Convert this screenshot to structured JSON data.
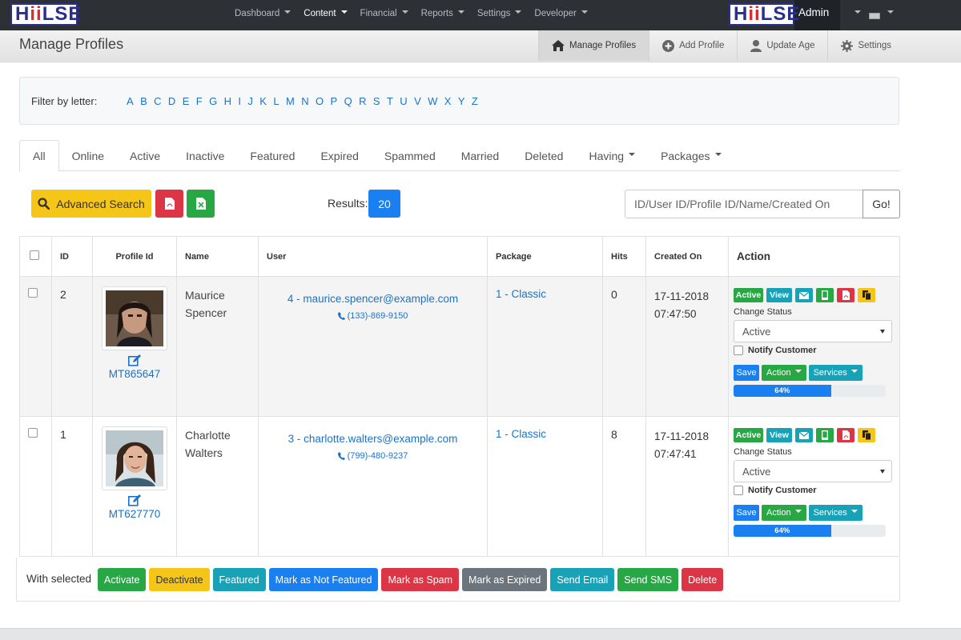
{
  "brand": {
    "logo_left": "HiiLSE",
    "logo_right": "HiiLSE"
  },
  "topnav": {
    "items": [
      {
        "label": "Dashboard",
        "active": false
      },
      {
        "label": "Content",
        "active": true
      },
      {
        "label": "Financial",
        "active": false
      },
      {
        "label": "Reports",
        "active": false
      },
      {
        "label": "Settings",
        "active": false
      },
      {
        "label": "Developer",
        "active": false
      }
    ],
    "user": "Admin"
  },
  "header": {
    "title": "Manage Profiles",
    "subnav": [
      {
        "label": "Manage Profiles",
        "icon": "home-icon"
      },
      {
        "label": "Add Profile",
        "icon": "plus-circle-icon"
      },
      {
        "label": "Update Age",
        "icon": "user-icon"
      },
      {
        "label": "Settings",
        "icon": "gear-icon"
      }
    ]
  },
  "filter": {
    "label": "Filter by letter:",
    "letters": [
      "A",
      "B",
      "C",
      "D",
      "E",
      "F",
      "G",
      "H",
      "I",
      "J",
      "K",
      "L",
      "M",
      "N",
      "O",
      "P",
      "Q",
      "R",
      "S",
      "T",
      "U",
      "V",
      "W",
      "X",
      "Y",
      "Z"
    ]
  },
  "tabs": [
    "All",
    "Online",
    "Active",
    "Inactive",
    "Featured",
    "Expired",
    "Spammed",
    "Married",
    "Deleted",
    "Having",
    "Packages"
  ],
  "toolbar": {
    "advanced_search": "Advanced Search",
    "results_label": "Results:",
    "results_count": "20",
    "search_placeholder": "ID/User ID/Profile ID/Name/Created On",
    "go": "Go!"
  },
  "table": {
    "headers": {
      "id": "ID",
      "profile_id": "Profile Id",
      "name": "Name",
      "user": "User",
      "package": "Package",
      "hits": "Hits",
      "created_on": "Created On",
      "action": "Action"
    },
    "rows": [
      {
        "id": "2",
        "profile_code": "MT865647",
        "name_first": "Maurice",
        "name_last": "Spencer",
        "user": "4 - maurice.spencer@example.com",
        "phone": "(133)-869-9150",
        "package": "1 - Classic",
        "hits": "0",
        "created_date": "17-11-2018",
        "created_time": "07:47:50",
        "status": "Active",
        "progress": "64%"
      },
      {
        "id": "1",
        "profile_code": "MT627770",
        "name_first": "Charlotte",
        "name_last": "Walters",
        "user": "3 - charlotte.walters@example.com",
        "phone": "(799)-480-9237",
        "package": "1 - Classic",
        "hits": "8",
        "created_date": "17-11-2018",
        "created_time": "07:47:41",
        "status": "Active",
        "progress": "64%"
      }
    ],
    "action_labels": {
      "active": "Active",
      "view": "View",
      "change_status": "Change Status",
      "notify": "Notify Customer",
      "save": "Save",
      "action": "Action",
      "services": "Services"
    }
  },
  "bulk": {
    "label": "With selected",
    "buttons": [
      "Activate",
      "Deactivate",
      "Featured",
      "Mark as Not Featured",
      "Mark as Spam",
      "Mark as Expired",
      "Send Email",
      "Send SMS",
      "Delete"
    ]
  },
  "colors": {
    "primary": "#1a7ff0",
    "success": "#28a745",
    "warning": "#f5c518",
    "danger": "#dc3545",
    "info": "#17a2b8",
    "secondary": "#6c757d",
    "topbar": "#2d3035"
  }
}
